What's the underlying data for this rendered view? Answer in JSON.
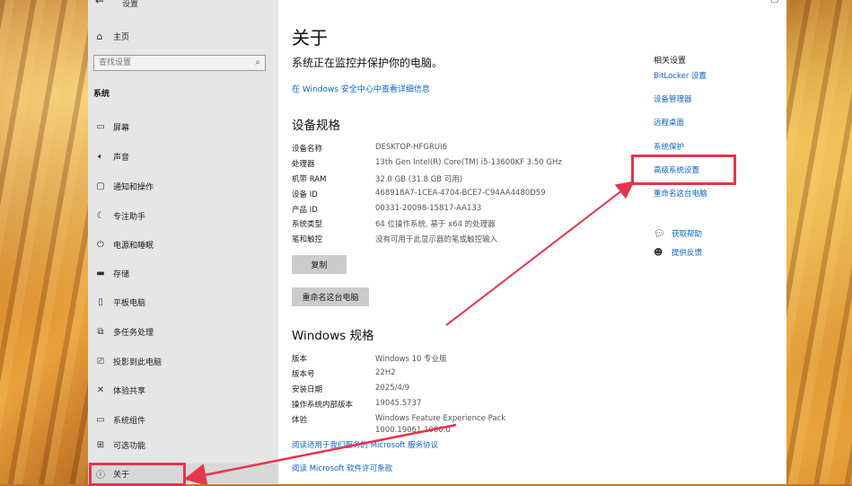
{
  "window": {
    "title": "设置",
    "back_icon": "back-arrow-icon"
  },
  "sidebar": {
    "home_label": "主页",
    "search_placeholder": "查找设置",
    "section": "系统",
    "items": [
      {
        "label": "屏幕",
        "icon": "monitor-icon"
      },
      {
        "label": "声音",
        "icon": "speaker-icon"
      },
      {
        "label": "通知和操作",
        "icon": "notification-icon"
      },
      {
        "label": "专注助手",
        "icon": "moon-icon"
      },
      {
        "label": "电源和睡眠",
        "icon": "power-icon"
      },
      {
        "label": "存储",
        "icon": "storage-icon"
      },
      {
        "label": "平板电脑",
        "icon": "tablet-icon"
      },
      {
        "label": "多任务处理",
        "icon": "multitask-icon"
      },
      {
        "label": "投影到此电脑",
        "icon": "project-icon"
      },
      {
        "label": "体验共享",
        "icon": "share-icon"
      },
      {
        "label": "系统组件",
        "icon": "components-icon"
      },
      {
        "label": "可选功能",
        "icon": "optional-features-icon"
      },
      {
        "label": "关于",
        "icon": "info-icon"
      }
    ]
  },
  "main": {
    "title": "关于",
    "protect_text": "系统正在监控并保护你的电脑。",
    "protect_link": "在 Windows 安全中心中查看详细信息",
    "device_specs_title": "设备规格",
    "device_specs": [
      {
        "k": "设备名称",
        "v": "DESKTOP-HFGRUI6"
      },
      {
        "k": "处理器",
        "v": "13th Gen Intel(R) Core(TM) i5-13600KF   3.50 GHz"
      },
      {
        "k": "机带 RAM",
        "v": "32.0 GB (31.8 GB 可用)"
      },
      {
        "k": "设备 ID",
        "v": "468918A7-1CEA-4704-BCE7-C94AA4480D59"
      },
      {
        "k": "产品 ID",
        "v": "00331-20098-15817-AA133"
      },
      {
        "k": "系统类型",
        "v": "64 位操作系统, 基于 x64 的处理器"
      },
      {
        "k": "笔和触控",
        "v": "没有可用于此显示器的笔或触控输入"
      }
    ],
    "copy_button": "复制",
    "rename_button": "重命名这台电脑",
    "windows_specs_title": "Windows 规格",
    "windows_specs": [
      {
        "k": "版本",
        "v": "Windows 10 专业版"
      },
      {
        "k": "版本号",
        "v": "22H2"
      },
      {
        "k": "安装日期",
        "v": "2025/4/9"
      },
      {
        "k": "操作系统内部版本",
        "v": "19045.5737"
      },
      {
        "k": "体验",
        "v": "Windows Feature Experience Pack"
      }
    ],
    "experience_version": "1000.19061.1000.0",
    "service_link": "阅读适用于我们服务的 Microsoft 服务协议",
    "license_link": "阅读 Microsoft 软件许可条款"
  },
  "related": {
    "title": "相关设置",
    "links": [
      "BitLocker 设置",
      "设备管理器",
      "远程桌面",
      "系统保护",
      "高级系统设置",
      "重命名这台电脑"
    ],
    "help": [
      {
        "label": "获取帮助",
        "icon": "help-chat-icon"
      },
      {
        "label": "提供反馈",
        "icon": "feedback-icon"
      }
    ]
  },
  "annotation_color": "#e8334a"
}
